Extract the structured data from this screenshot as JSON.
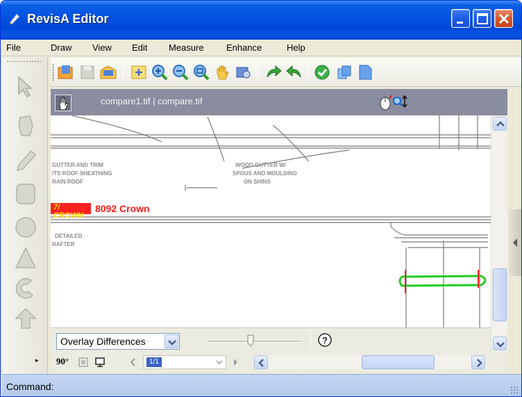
{
  "window": {
    "title": "RevisA Editor",
    "accent_color": "#0553e0"
  },
  "menu": {
    "items": [
      "File",
      "Draw",
      "View",
      "Edit",
      "Measure",
      "Enhance",
      "Help"
    ]
  },
  "toolbar": {
    "icons": [
      "open-folder-icon",
      "save-icon",
      "open-icon",
      "fit-page-icon",
      "zoom-in-icon",
      "zoom-out-icon",
      "zoom-window-icon",
      "pan-hand-icon",
      "preview-icon",
      "redo-icon",
      "undo-icon",
      "check-icon",
      "copy-icon",
      "page-icon"
    ]
  },
  "palette": {
    "tools": [
      "pointer-icon",
      "stamp-icon",
      "pencil-icon",
      "rectangle-icon",
      "ellipse-icon",
      "triangle-icon",
      "arc-icon",
      "arrow-icon"
    ],
    "expander": "▸"
  },
  "document": {
    "title": "compare1.tif | compare.tif",
    "annotation_label": "8092 Crown",
    "annotation_tag": "7/ CROWN",
    "drawing_notes": [
      "GUTTER AND TRIM",
      "ITS ROOF SHEATHING",
      "RAIN ROOF",
      "DETAILED",
      "RAFTER",
      "WOOD GUTTER W/",
      "SPOUS AND MOULDING",
      "ON SHINS"
    ],
    "highlight_color": "#22cc22",
    "diff_color": "#ff1a1a"
  },
  "overlay": {
    "mode": "Overlay Differences",
    "slider_level": 0.46,
    "help_label": "?"
  },
  "pagebar": {
    "rotation": "90°",
    "page": "1/1"
  },
  "status": {
    "command_label": "Command:"
  }
}
